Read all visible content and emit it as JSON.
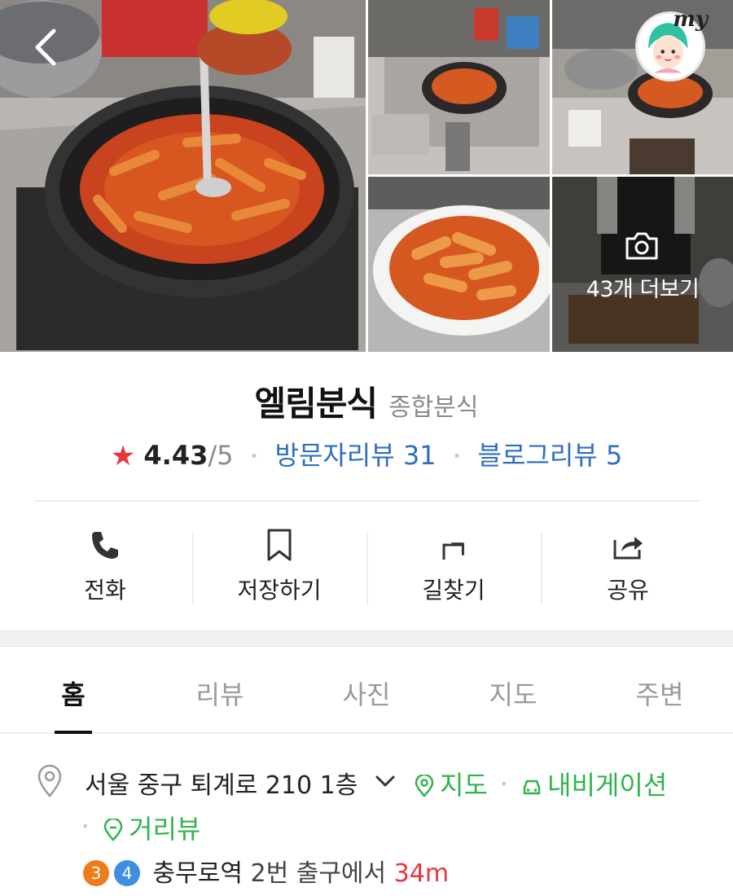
{
  "header": {
    "back_icon": "chevron-left-icon",
    "my_label": "my",
    "more_photos_label": "43개 더보기",
    "camera_icon": "camera-icon"
  },
  "place": {
    "name": "엘림분식",
    "category": "종합분식",
    "rating": "4.43",
    "rating_max": "/5",
    "visitor_reviews": "방문자리뷰 31",
    "blog_reviews": "블로그리뷰 5"
  },
  "actions": [
    {
      "label": "전화",
      "icon": "phone-icon"
    },
    {
      "label": "저장하기",
      "icon": "bookmark-icon"
    },
    {
      "label": "길찾기",
      "icon": "directions-icon"
    },
    {
      "label": "공유",
      "icon": "share-icon"
    }
  ],
  "tabs": [
    {
      "label": "홈",
      "active": true
    },
    {
      "label": "리뷰",
      "active": false
    },
    {
      "label": "사진",
      "active": false
    },
    {
      "label": "지도",
      "active": false
    },
    {
      "label": "주변",
      "active": false
    }
  ],
  "info": {
    "address": "서울 중구 퇴계로 210 1층",
    "map_link": "지도",
    "navigation_link": "내비게이션",
    "street_view_link": "거리뷰",
    "subway_lines": [
      "3",
      "4"
    ],
    "station": "충무로역",
    "exit": "2번 출구에서",
    "distance": "34m"
  },
  "colors": {
    "accent_blue": "#2f6fc0",
    "link_green": "#2fb54b",
    "star_red": "#e8363d",
    "line_3": "#ef7c1c",
    "line_4": "#3f8ee3"
  }
}
